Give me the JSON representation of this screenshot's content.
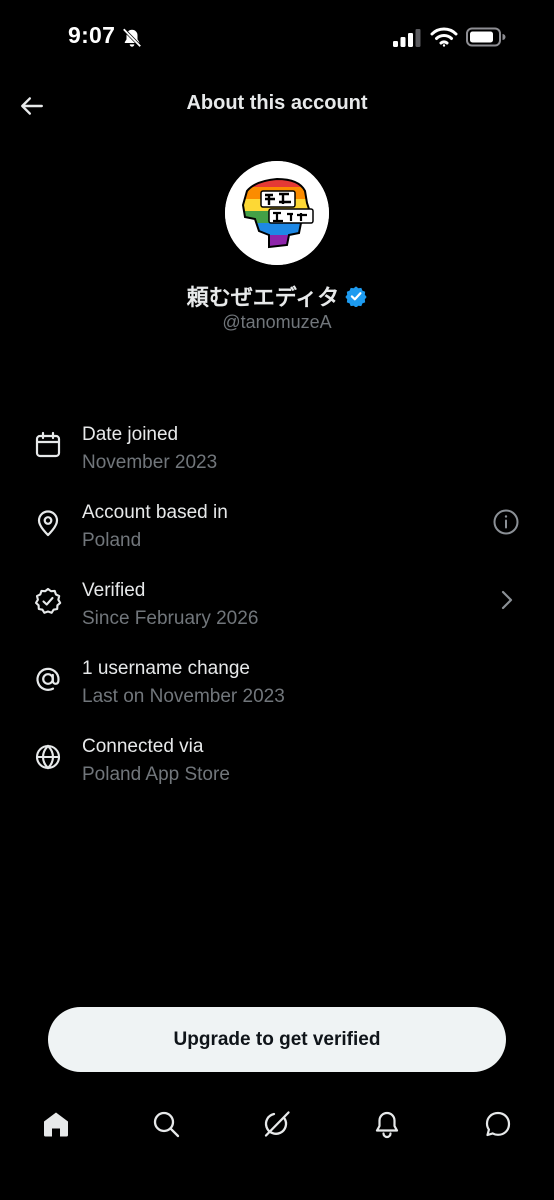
{
  "status_bar": {
    "time": "9:07",
    "icons": [
      "bell-slash-icon",
      "cellular-signal-icon",
      "wifi-icon",
      "battery-icon"
    ]
  },
  "header": {
    "title": "About this account",
    "back_icon": "arrow-left-icon"
  },
  "profile": {
    "display_name": "頼むぜエディタ",
    "handle": "@tanomuzeA",
    "verified_color": "#1d9bf0"
  },
  "info_rows": [
    {
      "icon": "calendar-icon",
      "label": "Date joined",
      "value": "November 2023"
    },
    {
      "icon": "location-pin-icon",
      "label": "Account based in",
      "value": "Poland",
      "trailing_icon": "info-icon"
    },
    {
      "icon": "verified-seal-icon",
      "label": "Verified",
      "value": "Since February 2026",
      "trailing_icon": "chevron-right-icon"
    },
    {
      "icon": "at-sign-icon",
      "label": "1 username change",
      "value": "Last on November 2023"
    },
    {
      "icon": "globe-icon",
      "label": "Connected via",
      "value": "Poland App Store"
    }
  ],
  "upgrade_button": {
    "label": "Upgrade to get verified"
  },
  "tab_bar": {
    "tabs": [
      "home-icon",
      "search-icon",
      "grok-icon",
      "notifications-icon",
      "messages-icon"
    ]
  },
  "colors": {
    "background": "#000000",
    "primary_text": "#e7e9ea",
    "secondary_text": "#71767b",
    "button_bg": "#eff3f4",
    "accent": "#1d9bf0"
  }
}
